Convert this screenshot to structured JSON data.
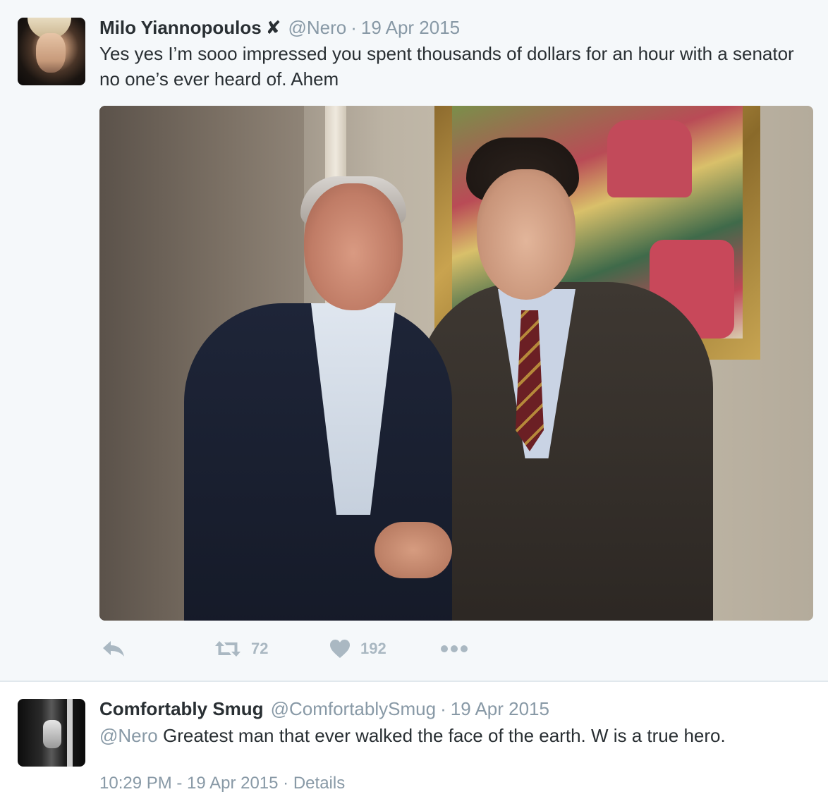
{
  "tweet": {
    "author_name": "Milo Yiannopoulos",
    "verified_mark": "✘",
    "handle": "@Nero",
    "separator": "·",
    "date": "19 Apr 2015",
    "text": "Yes yes I’m sooo impressed you spent thousands of dollars for an hour with a senator no one’s ever heard of. Ahem",
    "actions": {
      "retweet_count": "72",
      "like_count": "192"
    }
  },
  "reply": {
    "author_name": "Comfortably Smug",
    "handle": "@ComfortablySmug",
    "separator": "·",
    "date": "19 Apr 2015",
    "mention": "@Nero",
    "text": " Greatest man that ever walked the face of the earth. W is a true hero.",
    "timestamp": "10:29 PM - 19 Apr 2015",
    "footer_separator": "·",
    "details_link": "Details"
  },
  "icons": {
    "reply": "reply-icon",
    "retweet": "retweet-icon",
    "like": "heart-icon",
    "more": "more-icon"
  },
  "colors": {
    "background_main": "#f5f8fa",
    "text_primary": "#292f33",
    "text_secondary": "#8899a6",
    "action_icons": "#aab8c2"
  }
}
